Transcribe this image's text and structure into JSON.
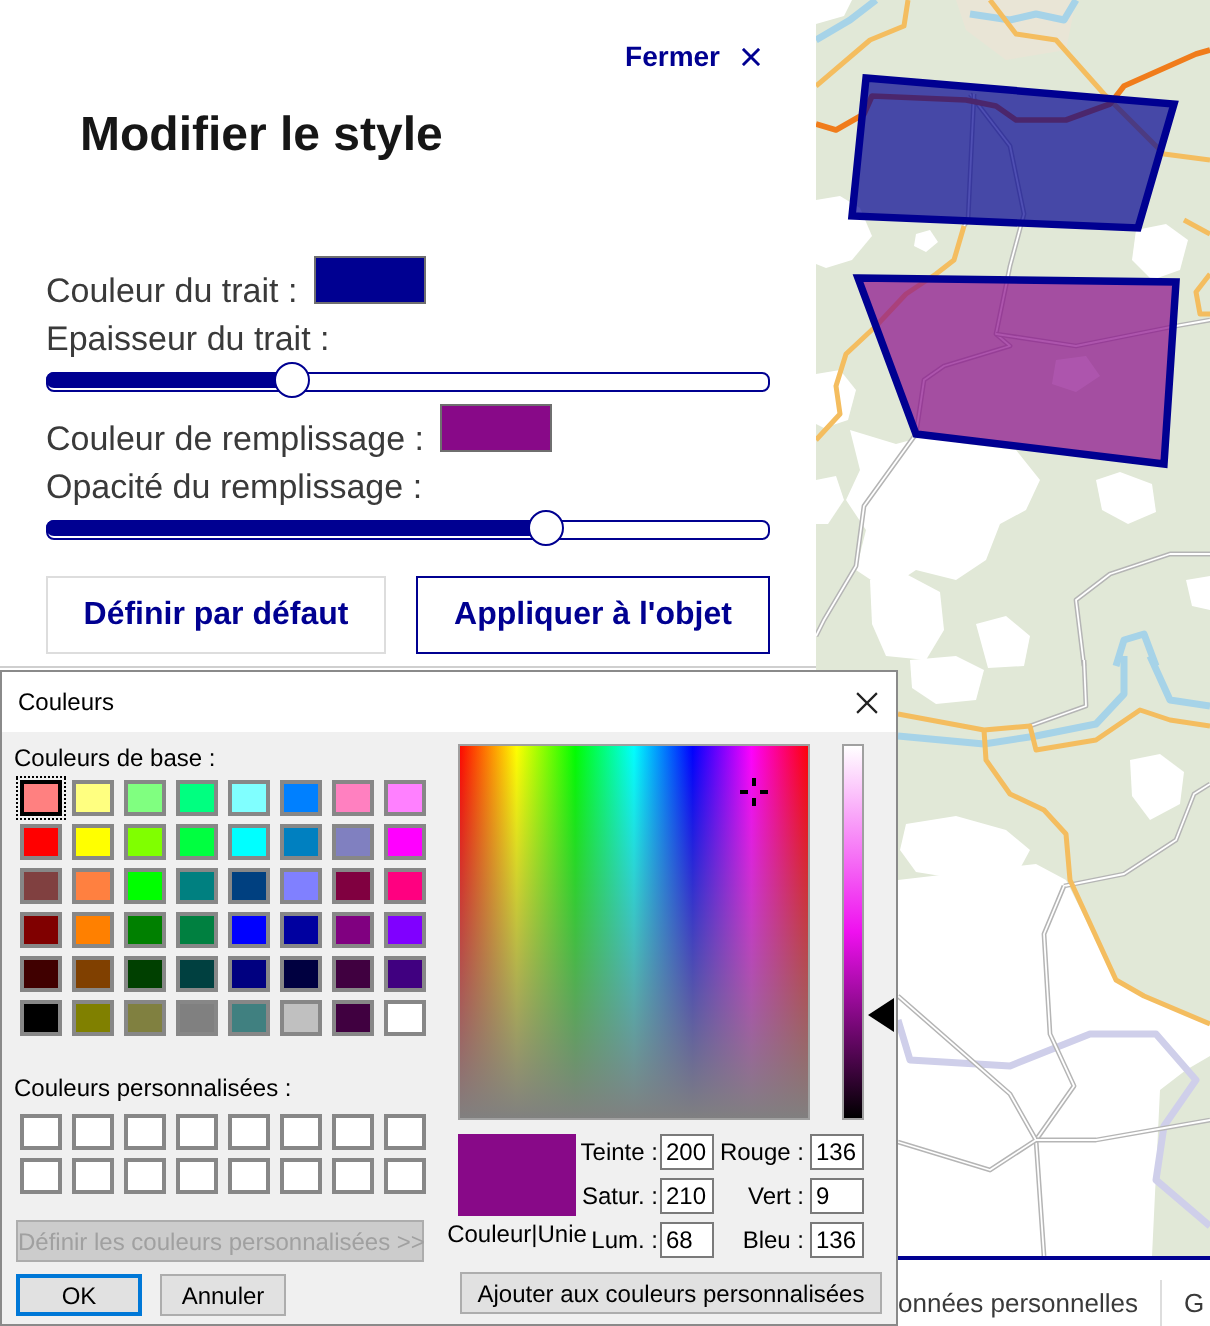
{
  "panel": {
    "close_label": "Fermer",
    "title": "Modifier le style",
    "fields": [
      {
        "kind": "color",
        "label": "Couleur du trait :",
        "color": "#000091"
      },
      {
        "kind": "slider",
        "label": "Epaisseur du trait :",
        "level": 0.34
      },
      {
        "kind": "color",
        "label": "Couleur de remplissage :",
        "color": "#880988"
      },
      {
        "kind": "slider",
        "label": "Opacité du remplissage :",
        "level": 0.69
      }
    ],
    "buttons": [
      {
        "label": "Définir par défaut",
        "kind": "secondary"
      },
      {
        "label": "Appliquer à l'objet",
        "kind": "primary"
      }
    ]
  },
  "footer": {
    "links": [
      "onnées personnelles",
      "G"
    ]
  },
  "dialog": {
    "title": "Couleurs",
    "basic_label": "Couleurs de base :",
    "basic_colors": [
      {
        "color": "#ff8080",
        "selected": true
      },
      {
        "color": "#ffff80",
        "selected": false
      },
      {
        "color": "#80ff80",
        "selected": false
      },
      {
        "color": "#00ff80",
        "selected": false
      },
      {
        "color": "#80ffff",
        "selected": false
      },
      {
        "color": "#0080ff",
        "selected": false
      },
      {
        "color": "#ff80c0",
        "selected": false
      },
      {
        "color": "#ff80ff",
        "selected": false
      },
      {
        "color": "#ff0000",
        "selected": false
      },
      {
        "color": "#ffff00",
        "selected": false
      },
      {
        "color": "#80ff00",
        "selected": false
      },
      {
        "color": "#00ff40",
        "selected": false
      },
      {
        "color": "#00ffff",
        "selected": false
      },
      {
        "color": "#0080c0",
        "selected": false
      },
      {
        "color": "#8080c0",
        "selected": false
      },
      {
        "color": "#ff00ff",
        "selected": false
      },
      {
        "color": "#804040",
        "selected": false
      },
      {
        "color": "#ff8040",
        "selected": false
      },
      {
        "color": "#00ff00",
        "selected": false
      },
      {
        "color": "#008080",
        "selected": false
      },
      {
        "color": "#004080",
        "selected": false
      },
      {
        "color": "#8080ff",
        "selected": false
      },
      {
        "color": "#800040",
        "selected": false
      },
      {
        "color": "#ff0080",
        "selected": false
      },
      {
        "color": "#800000",
        "selected": false
      },
      {
        "color": "#ff8000",
        "selected": false
      },
      {
        "color": "#008000",
        "selected": false
      },
      {
        "color": "#008040",
        "selected": false
      },
      {
        "color": "#0000ff",
        "selected": false
      },
      {
        "color": "#0000a0",
        "selected": false
      },
      {
        "color": "#800080",
        "selected": false
      },
      {
        "color": "#8000ff",
        "selected": false
      },
      {
        "color": "#400000",
        "selected": false
      },
      {
        "color": "#804000",
        "selected": false
      },
      {
        "color": "#004000",
        "selected": false
      },
      {
        "color": "#004040",
        "selected": false
      },
      {
        "color": "#000080",
        "selected": false
      },
      {
        "color": "#000040",
        "selected": false
      },
      {
        "color": "#400040",
        "selected": false
      },
      {
        "color": "#400080",
        "selected": false
      },
      {
        "color": "#000000",
        "selected": false
      },
      {
        "color": "#808000",
        "selected": false
      },
      {
        "color": "#808040",
        "selected": false
      },
      {
        "color": "#808080",
        "selected": false
      },
      {
        "color": "#408080",
        "selected": false
      },
      {
        "color": "#c0c0c0",
        "selected": false
      },
      {
        "color": "#400040",
        "selected": false
      },
      {
        "color": "#ffffff",
        "selected": false
      }
    ],
    "custom_label": "Couleurs personnalisées :",
    "custom_colors": [
      {
        "color": "#ffffff"
      },
      {
        "color": "#ffffff"
      },
      {
        "color": "#ffffff"
      },
      {
        "color": "#ffffff"
      },
      {
        "color": "#ffffff"
      },
      {
        "color": "#ffffff"
      },
      {
        "color": "#ffffff"
      },
      {
        "color": "#ffffff"
      },
      {
        "color": "#ffffff"
      },
      {
        "color": "#ffffff"
      },
      {
        "color": "#ffffff"
      },
      {
        "color": "#ffffff"
      },
      {
        "color": "#ffffff"
      },
      {
        "color": "#ffffff"
      },
      {
        "color": "#ffffff"
      },
      {
        "color": "#ffffff"
      }
    ],
    "define_button": {
      "label": "Définir les couleurs personnalisées >>",
      "disabled": true
    },
    "buttons": [
      {
        "label": "OK",
        "default": true
      },
      {
        "label": "Annuler",
        "default": false
      }
    ],
    "luminance": {
      "level": 0.28
    },
    "preview": {
      "color": "#880988",
      "label": "Couleur|Unie"
    },
    "hsl_fields": [
      {
        "label": "Teinte :",
        "value": "200"
      },
      {
        "label": "Satur. :",
        "value": "210"
      },
      {
        "label": "Lum. :",
        "value": "68"
      }
    ],
    "rgb_fields": [
      {
        "label": "Rouge :",
        "value": "136"
      },
      {
        "label": "Vert :",
        "value": "9"
      },
      {
        "label": "Bleu :",
        "value": "136"
      }
    ],
    "add_button": "Ajouter aux couleurs personnalisées"
  }
}
